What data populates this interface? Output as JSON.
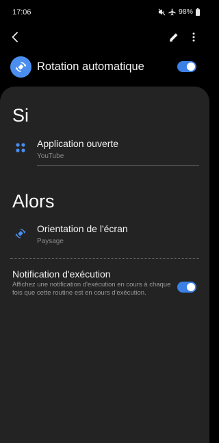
{
  "status_bar": {
    "time": "17:06",
    "battery": "98%",
    "icons": [
      "mute-icon",
      "airplane-icon",
      "battery-icon"
    ]
  },
  "toolbar": {
    "icons": [
      "back-icon",
      "edit-icon",
      "more-vert-icon"
    ]
  },
  "routine": {
    "title": "Rotation automatique",
    "icon": "auto-rotate-icon",
    "enabled": true,
    "accent_color": "#4a8eef"
  },
  "if_section": {
    "title": "Si",
    "condition": {
      "icon": "apps-grid-icon",
      "title": "Application ouverte",
      "subtitle": "YouTube"
    }
  },
  "then_section": {
    "title": "Alors",
    "action": {
      "icon": "screen-rotation-icon",
      "title": "Orientation de l'écran",
      "subtitle": "Paysage"
    }
  },
  "notification": {
    "title": "Notification d'exécution",
    "description": "Affichez une notification d'exécution en cours à chaque fois que cette routine est en cours d'exécution.",
    "enabled": true
  },
  "colors": {
    "background": "#000000",
    "card": "#232323",
    "toggle_on": "#3c80e5",
    "subtitle": "#8a8a8a"
  }
}
